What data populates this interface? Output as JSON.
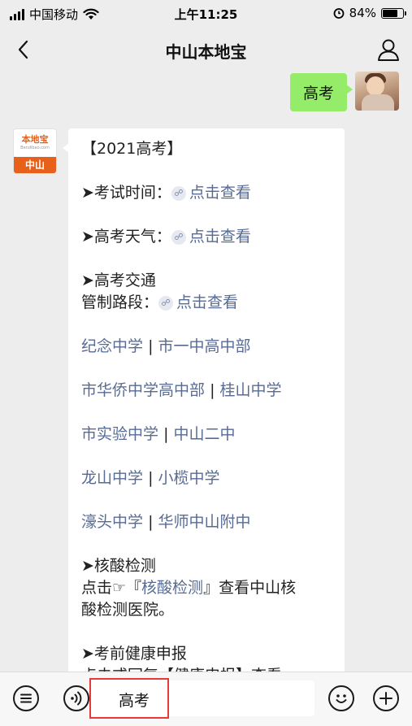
{
  "status_bar": {
    "carrier": "中国移动",
    "time": "上午11:25",
    "battery_percent": "84%",
    "battery_level": 0.84
  },
  "nav": {
    "title": "中山本地宝"
  },
  "chat": {
    "outgoing_message": "高考",
    "bot_avatar": {
      "top_text": "本地宝",
      "sub_text": "Bendibao.com",
      "bottom_text": "中山"
    },
    "article": {
      "heading": "【2021高考】",
      "exam_time_label": "➤考试时间：",
      "exam_time_link": "点击查看",
      "weather_label": "➤高考天气：",
      "weather_link": "点击查看",
      "traffic_label": "➤高考交通",
      "control_label": "管制路段：",
      "control_link": "点击查看",
      "schools": [
        [
          "纪念中学",
          "市一中高中部"
        ],
        [
          "市华侨中学高中部",
          "桂山中学"
        ],
        [
          "市实验中学",
          "中山二中"
        ],
        [
          "龙山中学",
          "小榄中学"
        ],
        [
          "濠头中学",
          "华师中山附中"
        ]
      ],
      "separator": "|",
      "nucleic_label": "➤核酸检测",
      "nucleic_prefix": "点击☞『",
      "nucleic_link": "核酸检测",
      "nucleic_suffix": "』查看中山核",
      "nucleic_line2": "酸检测医院。",
      "health_label": "➤考前健康申报",
      "health_line_partial": "点击或回复【健康申报】查看"
    }
  },
  "input_bar": {
    "text_value": "高考"
  },
  "colors": {
    "background": "#ededed",
    "outgoing_bubble": "#95ec69",
    "link": "#576b95",
    "highlight_box": "#e53b3b"
  }
}
